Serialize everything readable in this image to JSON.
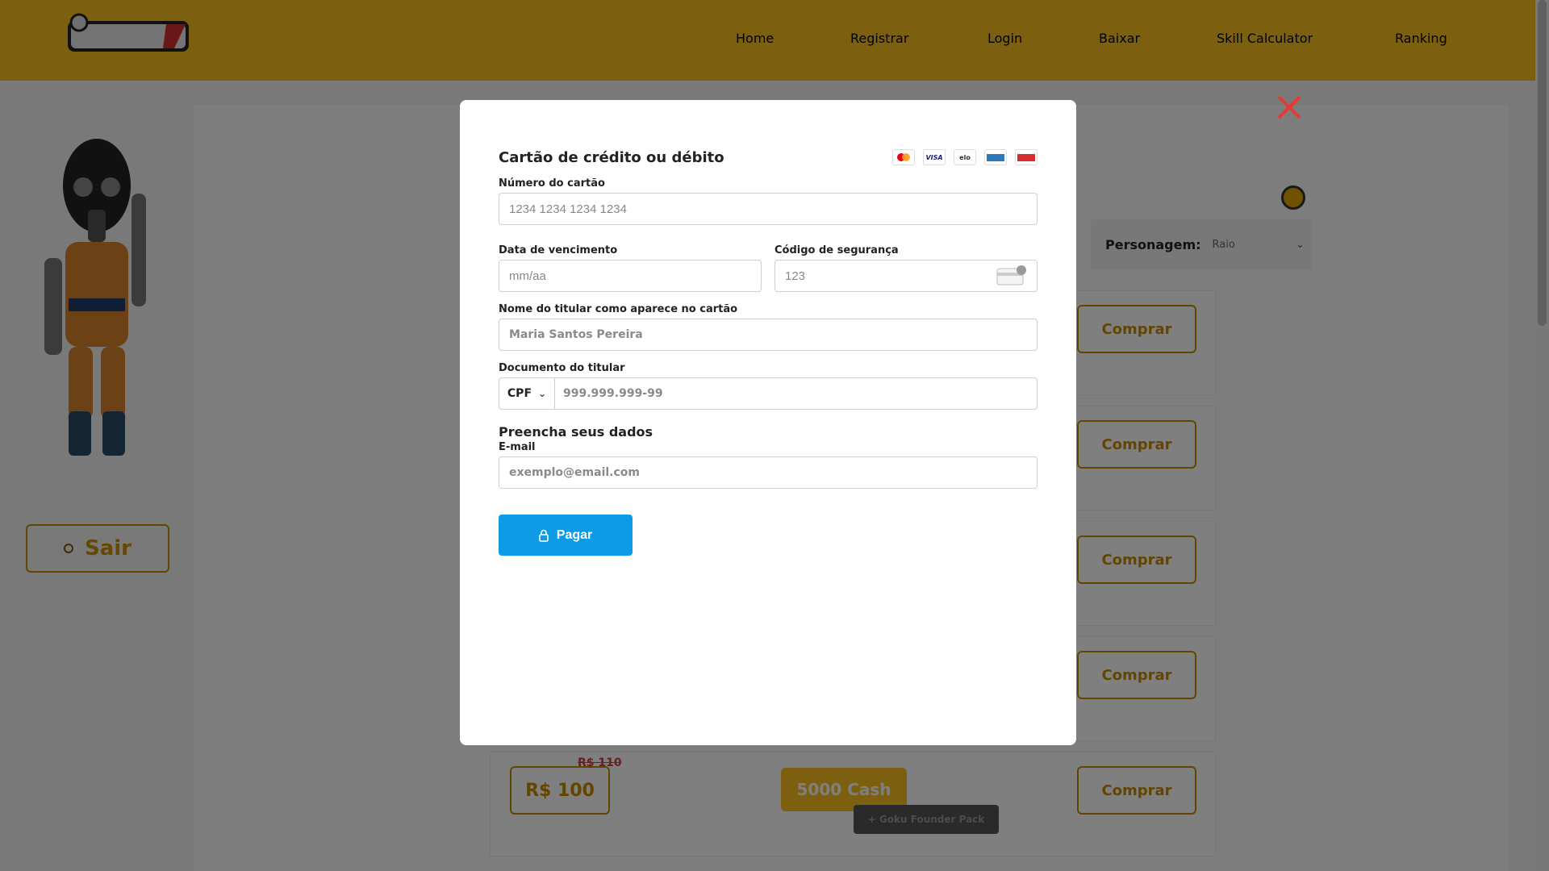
{
  "nav": {
    "items": [
      "Home",
      "Registrar",
      "Login",
      "Baixar",
      "Skill Calculator",
      "Ranking"
    ]
  },
  "sidebar": {
    "logout_label": "Sair"
  },
  "main": {
    "header_fragment": "o",
    "character_select": {
      "label": "Personagem:",
      "value": "Raio"
    },
    "buy_label": "Comprar",
    "last_package": {
      "price": "R$ 100",
      "old_price": "R$ 110",
      "cash": "5000 Cash",
      "bonus": "+ Goku Founder Pack"
    }
  },
  "modal": {
    "title": "Cartão de crédito ou débito",
    "card_brands": [
      "mastercard-icon",
      "visa-icon",
      "elo-icon",
      "amex-icon",
      "hipercard-icon"
    ],
    "card_number": {
      "label": "Número do cartão",
      "placeholder": "1234 1234 1234 1234"
    },
    "expiry": {
      "label": "Data de vencimento",
      "placeholder": "mm/aa"
    },
    "cvc": {
      "label": "Código de segurança",
      "placeholder": "123"
    },
    "holder_name": {
      "label": "Nome do titular como aparece no cartão",
      "placeholder": "Maria Santos Pereira"
    },
    "document": {
      "label": "Documento do titular",
      "type": "CPF",
      "placeholder": "999.999.999-99"
    },
    "section_title": "Preencha seus dados",
    "email": {
      "label": "E-mail",
      "placeholder": "exemplo@email.com"
    },
    "pay_label": "Pagar"
  },
  "colors": {
    "brand_yellow": "#f9c021",
    "pay_blue": "#0d9be6",
    "close_red": "#e53935"
  }
}
